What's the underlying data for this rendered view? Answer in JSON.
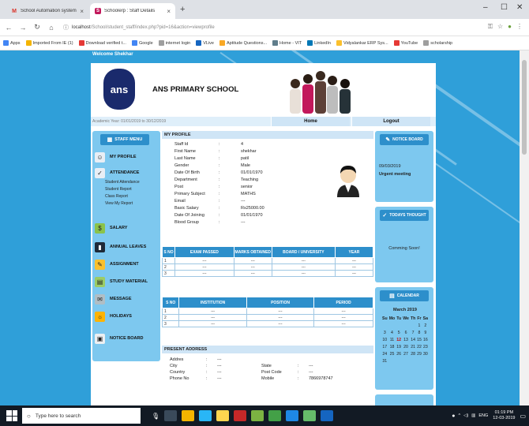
{
  "browser": {
    "tabs": [
      {
        "title": "School Automation system pap",
        "icon": "gmail-icon",
        "active": false
      },
      {
        "title": "Schoolerp : Staff Details",
        "icon": "schoolerp-icon",
        "active": true
      }
    ],
    "url_host": "localhost",
    "url_path": "/School/student_staff/index.php?pid=16&action=viewprofile",
    "bookmarks": [
      {
        "label": "Apps",
        "color": "#4285f4"
      },
      {
        "label": "Imported From IE (1)",
        "color": "#f4b400"
      },
      {
        "label": "Download verified t...",
        "color": "#e53935"
      },
      {
        "label": "Google",
        "color": "#4285f4"
      },
      {
        "label": "internet login",
        "color": "#9e9e9e"
      },
      {
        "label": "VLive",
        "color": "#1565c0"
      },
      {
        "label": "Aptitude Questions...",
        "color": "#f9a825"
      },
      {
        "label": "Home - VIT",
        "color": "#607d8b"
      },
      {
        "label": "LinkedIn",
        "color": "#0077b5"
      },
      {
        "label": "Vidyalankar ERP Sys...",
        "color": "#fbc02d"
      },
      {
        "label": "YouTube",
        "color": "#e53935"
      },
      {
        "label": "scholarship",
        "color": "#9e9e9e"
      }
    ]
  },
  "page": {
    "welcome": "Welcome Shekhar",
    "logo_text": "ans",
    "school_name": "ANS PRIMARY SCHOOL",
    "academic_year": "Academic Year: 01/01/2019 to 30/12/2019",
    "nav": {
      "home": "Home",
      "logout": "Logout"
    }
  },
  "sidebar": {
    "header": "STAFF MENU",
    "items": [
      {
        "label": "MY PROFILE",
        "icon": "profile-icon",
        "color": "#e8eef5"
      },
      {
        "label": "ATTENDANCE",
        "icon": "attendance-icon",
        "color": "#e8eef5"
      },
      {
        "label": "SALARY",
        "icon": "salary-icon",
        "color": "#8bc34a"
      },
      {
        "label": "ANNUAL LEAVES",
        "icon": "leaves-icon",
        "color": "#1e2a38"
      },
      {
        "label": "ASSIGNMENT",
        "icon": "pencil-icon",
        "color": "#fbc02d"
      },
      {
        "label": "STUDY MATERIAL",
        "icon": "books-icon",
        "color": "#9ccc65"
      },
      {
        "label": "MESSAGE",
        "icon": "message-icon",
        "color": "#b0bec5"
      },
      {
        "label": "HOLIDAYS",
        "icon": "holidays-icon",
        "color": "#ffb300"
      },
      {
        "label": "NOTICE BOARD",
        "icon": "notice-board-icon",
        "color": "#eceff1"
      }
    ],
    "attendance_sub": [
      "Student Attendance",
      "Student Report",
      "Class Report",
      "View My Report"
    ]
  },
  "profile": {
    "header": "MY PROFILE",
    "fields": [
      {
        "k": "Staff Id",
        "v": "4"
      },
      {
        "k": "First Name",
        "v": "shekhar"
      },
      {
        "k": "Last Name",
        "v": "patil"
      },
      {
        "k": "Gender",
        "v": "Male"
      },
      {
        "k": "Date Of Birth",
        "v": "01/01/1970"
      },
      {
        "k": "Department",
        "v": "Teaching"
      },
      {
        "k": "Post",
        "v": "senior"
      },
      {
        "k": "Primary Subject",
        "v": "MATHS"
      },
      {
        "k": "Email",
        "v": "---"
      },
      {
        "k": "Basic Salary",
        "v": "Rs25000.00"
      },
      {
        "k": "Date Of Joining",
        "v": "01/01/1970"
      },
      {
        "k": "Blood Group",
        "v": "---"
      }
    ],
    "separator": ":"
  },
  "education": {
    "headers": [
      "S NO",
      "EXAM PASSED",
      "MARKS OBTAINED",
      "BOARD / UNIVERSITY",
      "YEAR"
    ],
    "rows": [
      [
        "1",
        "---",
        "---",
        "---",
        "---"
      ],
      [
        "2",
        "---",
        "---",
        "---",
        "---"
      ],
      [
        "3",
        "---",
        "---",
        "---",
        "---"
      ]
    ]
  },
  "experience": {
    "headers": [
      "S NO",
      "INSTITUTION",
      "POSITION",
      "PERIOD"
    ],
    "rows": [
      [
        "1",
        "---",
        "---",
        "---"
      ],
      [
        "2",
        "---",
        "---",
        "---"
      ],
      [
        "3",
        "---",
        "---",
        "---"
      ]
    ]
  },
  "address": {
    "header": "PRESENT ADDRESS",
    "left": [
      {
        "k": "Addres",
        "v": "---"
      },
      {
        "k": "City",
        "v": "---"
      },
      {
        "k": "Country",
        "v": "---"
      },
      {
        "k": "Phone No",
        "v": "---"
      }
    ],
    "right": [
      {
        "k": "State",
        "v": "---"
      },
      {
        "k": "Post Code",
        "v": "---"
      },
      {
        "k": "Mobile",
        "v": "7866978747"
      }
    ],
    "separator": ":"
  },
  "notice": {
    "header": "NOTICE BOARD",
    "date": "09/03/2019",
    "text": "Urgent meeting"
  },
  "thought": {
    "header": "TODAYS THOUGHT",
    "text": "Comming Soon!"
  },
  "calendar": {
    "header": "CALENDAR",
    "month": "March 2019",
    "days": [
      "Su",
      "Mo",
      "Tu",
      "We",
      "Th",
      "Fr",
      "Sa"
    ],
    "weeks": [
      [
        "",
        "",
        "",
        "",
        "",
        "1",
        "2"
      ],
      [
        "3",
        "4",
        "5",
        "6",
        "7",
        "8",
        "9"
      ],
      [
        "10",
        "11",
        "12",
        "13",
        "14",
        "15",
        "16"
      ],
      [
        "17",
        "18",
        "19",
        "20",
        "21",
        "22",
        "23"
      ],
      [
        "24",
        "25",
        "26",
        "27",
        "28",
        "29",
        "30"
      ],
      [
        "31",
        "",
        "",
        "",
        "",
        "",
        ""
      ]
    ],
    "today": "12"
  },
  "taskbar": {
    "search_placeholder": "Type here to search",
    "lang": "ENG",
    "time": "01:19 PM",
    "date": "12-03-2019"
  }
}
